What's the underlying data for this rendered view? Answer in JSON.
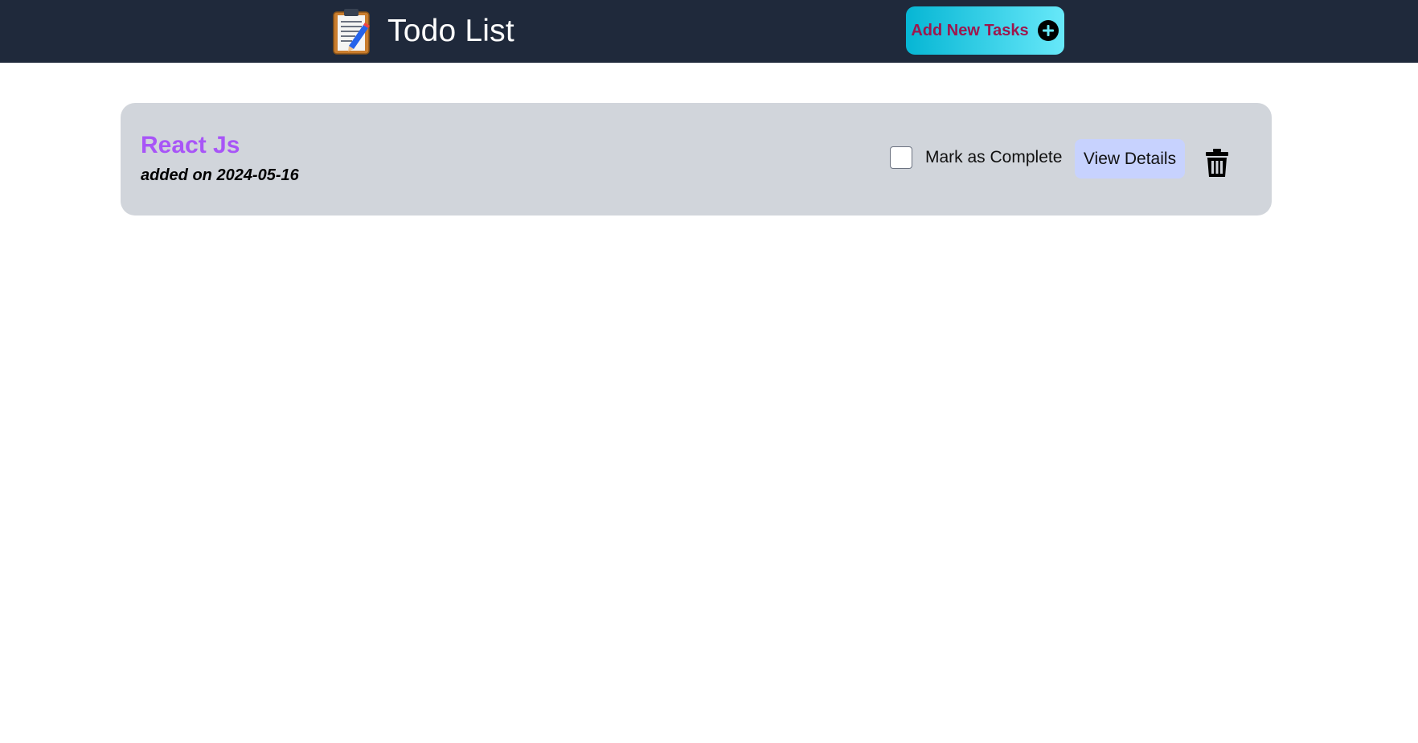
{
  "header": {
    "title": "Todo List",
    "icon": "clipboard-pencil-icon",
    "add_button_label": "Add New Tasks",
    "add_button_icon": "plus-circle-icon"
  },
  "tasks": [
    {
      "title": "React Js",
      "date_text": "added on 2024-05-16",
      "complete_label": "Mark as Complete",
      "completed": false,
      "view_label": "View Details",
      "delete_icon": "trash-icon"
    }
  ],
  "colors": {
    "navbar_bg": "#1f293b",
    "card_bg": "#d1d5db",
    "task_title": "#a855f7",
    "add_button_text": "#9d174d",
    "view_button_bg": "#c7d2fe"
  }
}
